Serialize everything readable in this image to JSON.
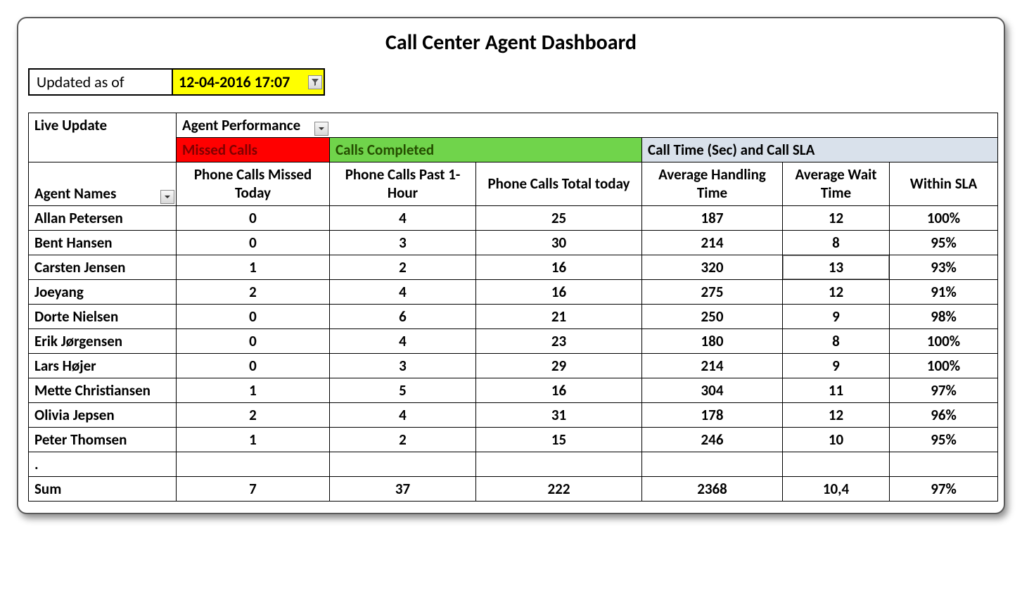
{
  "title": "Call Center Agent Dashboard",
  "updated": {
    "label": "Updated as of",
    "value": "12-04-2016 17:07"
  },
  "headers": {
    "live_update": "Live Update",
    "agent_performance": "Agent Performance",
    "agent_names": "Agent Names",
    "missed_calls": "Missed Calls",
    "calls_completed": "Calls Completed",
    "call_time_sla": "Call Time (Sec) and Call SLA",
    "col_missed": "Phone Calls Missed Today",
    "col_past_hour": "Phone Calls Past 1-Hour",
    "col_total_today": "Phone Calls Total today",
    "col_avg_handle": "Average Handling Time",
    "col_avg_wait": "Average Wait Time",
    "col_sla": "Within SLA"
  },
  "rows": [
    {
      "name": "Allan Petersen",
      "missed": "0",
      "past_hour": "4",
      "total": "25",
      "aht": "187",
      "await": "12",
      "sla": "100%"
    },
    {
      "name": "Bent Hansen",
      "missed": "0",
      "past_hour": "3",
      "total": "30",
      "aht": "214",
      "await": "8",
      "sla": "95%"
    },
    {
      "name": "Carsten Jensen",
      "missed": "1",
      "past_hour": "2",
      "total": "16",
      "aht": "320",
      "await": "13",
      "sla": "93%"
    },
    {
      "name": "Joeyang",
      "missed": "2",
      "past_hour": "4",
      "total": "16",
      "aht": "275",
      "await": "12",
      "sla": "91%"
    },
    {
      "name": "Dorte Nielsen",
      "missed": "0",
      "past_hour": "6",
      "total": "21",
      "aht": "250",
      "await": "9",
      "sla": "98%"
    },
    {
      "name": "Erik Jørgensen",
      "missed": "0",
      "past_hour": "4",
      "total": "23",
      "aht": "180",
      "await": "8",
      "sla": "100%"
    },
    {
      "name": "Lars Højer",
      "missed": "0",
      "past_hour": "3",
      "total": "29",
      "aht": "214",
      "await": "9",
      "sla": "100%"
    },
    {
      "name": "Mette Christiansen",
      "missed": "1",
      "past_hour": "5",
      "total": "16",
      "aht": "304",
      "await": "11",
      "sla": "97%"
    },
    {
      "name": "Olivia Jepsen",
      "missed": "2",
      "past_hour": "4",
      "total": "31",
      "aht": "178",
      "await": "12",
      "sla": "96%"
    },
    {
      "name": "Peter Thomsen",
      "missed": "1",
      "past_hour": "2",
      "total": "15",
      "aht": "246",
      "await": "10",
      "sla": "95%"
    }
  ],
  "dot": ".",
  "sum": {
    "label": "Sum",
    "missed": "7",
    "past_hour": "37",
    "total": "222",
    "aht": "2368",
    "await": "10,4",
    "sla": "97%"
  },
  "selected_cell": {
    "row_index": 2,
    "column": "await"
  },
  "chart_data": {
    "type": "table",
    "title": "Call Center Agent Dashboard",
    "columns": [
      "Agent Names",
      "Phone Calls Missed Today",
      "Phone Calls Past 1-Hour",
      "Phone Calls Total today",
      "Average Handling Time",
      "Average Wait Time",
      "Within SLA"
    ],
    "rows": [
      [
        "Allan Petersen",
        0,
        4,
        25,
        187,
        12,
        "100%"
      ],
      [
        "Bent Hansen",
        0,
        3,
        30,
        214,
        8,
        "95%"
      ],
      [
        "Carsten Jensen",
        1,
        2,
        16,
        320,
        13,
        "93%"
      ],
      [
        "Joeyang",
        2,
        4,
        16,
        275,
        12,
        "91%"
      ],
      [
        "Dorte Nielsen",
        0,
        6,
        21,
        250,
        9,
        "98%"
      ],
      [
        "Erik Jørgensen",
        0,
        4,
        23,
        180,
        8,
        "100%"
      ],
      [
        "Lars Højer",
        0,
        3,
        29,
        214,
        9,
        "100%"
      ],
      [
        "Mette Christiansen",
        1,
        5,
        16,
        304,
        11,
        "97%"
      ],
      [
        "Olivia Jepsen",
        2,
        4,
        31,
        178,
        12,
        "96%"
      ],
      [
        "Peter Thomsen",
        1,
        2,
        15,
        246,
        10,
        "95%"
      ]
    ],
    "summary": [
      "Sum",
      7,
      37,
      222,
      2368,
      "10,4",
      "97%"
    ]
  }
}
